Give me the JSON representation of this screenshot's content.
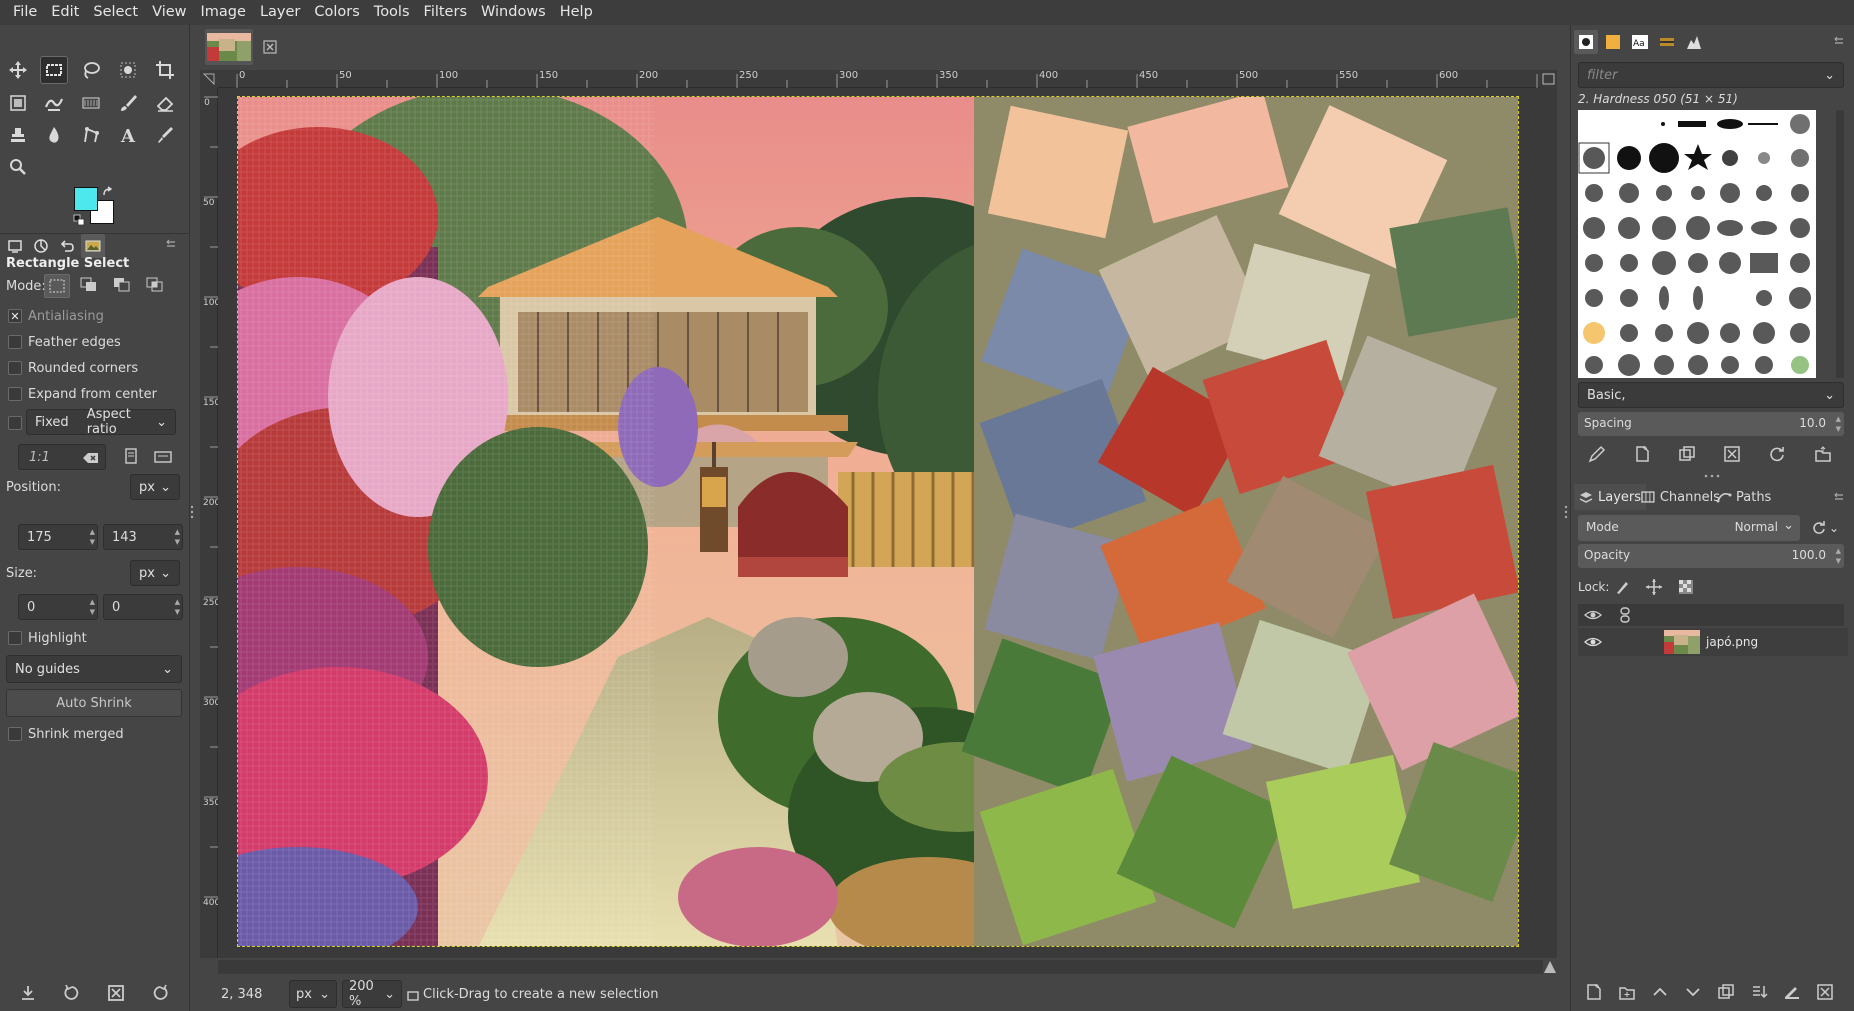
{
  "menubar": {
    "items": [
      "File",
      "Edit",
      "Select",
      "View",
      "Image",
      "Layer",
      "Colors",
      "Tools",
      "Filters",
      "Windows",
      "Help"
    ]
  },
  "toolbox": {
    "tools": [
      {
        "name": "move-tool-icon"
      },
      {
        "name": "rect-select-tool-icon"
      },
      {
        "name": "lasso-tool-icon"
      },
      {
        "name": "foreground-select-tool-icon"
      },
      {
        "name": "crop-tool-icon"
      },
      {
        "name": "unified-transform-tool-icon"
      },
      {
        "name": "warp-tool-icon"
      },
      {
        "name": "gradient-tool-icon"
      },
      {
        "name": "paintbrush-tool-icon"
      },
      {
        "name": "eraser-tool-icon"
      },
      {
        "name": "clone-tool-icon"
      },
      {
        "name": "smudge-tool-icon"
      },
      {
        "name": "paths-tool-icon"
      },
      {
        "name": "text-tool-icon"
      },
      {
        "name": "color-picker-tool-icon"
      },
      {
        "name": "zoom-tool-icon"
      }
    ],
    "fg_color": "#4de8ee",
    "bg_color": "#ffffff"
  },
  "tool_options": {
    "title": "Rectangle Select",
    "mode_label": "Mode:",
    "antialiasing": "Antialiasing",
    "feather_edges": "Feather edges",
    "rounded_corners": "Rounded corners",
    "expand_from_center": "Expand from center",
    "fixed_label": "Fixed",
    "fixed_option": "Aspect ratio",
    "ratio_value": "1:1",
    "position_label": "Position:",
    "position_unit": "px",
    "position_x": "175",
    "position_y": "143",
    "size_label": "Size:",
    "size_unit": "px",
    "size_w": "0",
    "size_h": "0",
    "highlight": "Highlight",
    "guides": "No guides",
    "auto_shrink": "Auto Shrink",
    "shrink_merged": "Shrink merged"
  },
  "ruler": {
    "h_ticks": [
      "0",
      "50",
      "100",
      "150",
      "200",
      "250",
      "300",
      "350",
      "400",
      "450",
      "500",
      "550",
      "600"
    ],
    "v_ticks": [
      "0",
      "50",
      "100",
      "150",
      "200",
      "250",
      "300",
      "350",
      "400"
    ]
  },
  "statusbar": {
    "coords": "2, 348",
    "unit": "px",
    "zoom": "200 %",
    "message": "Click-Drag to create a new selection"
  },
  "brushes": {
    "filter_placeholder": "filter",
    "current_brush": "2. Hardness 050 (51 × 51)",
    "preset": "Basic,",
    "spacing_label": "Spacing",
    "spacing_value": "10.0"
  },
  "layers": {
    "tabs": [
      "Layers",
      "Channels",
      "Paths"
    ],
    "mode_label": "Mode",
    "mode_value": "Normal",
    "opacity_label": "Opacity",
    "opacity_value": "100.0",
    "lock_label": "Lock:",
    "items": [
      {
        "name": "japó.png"
      }
    ]
  }
}
